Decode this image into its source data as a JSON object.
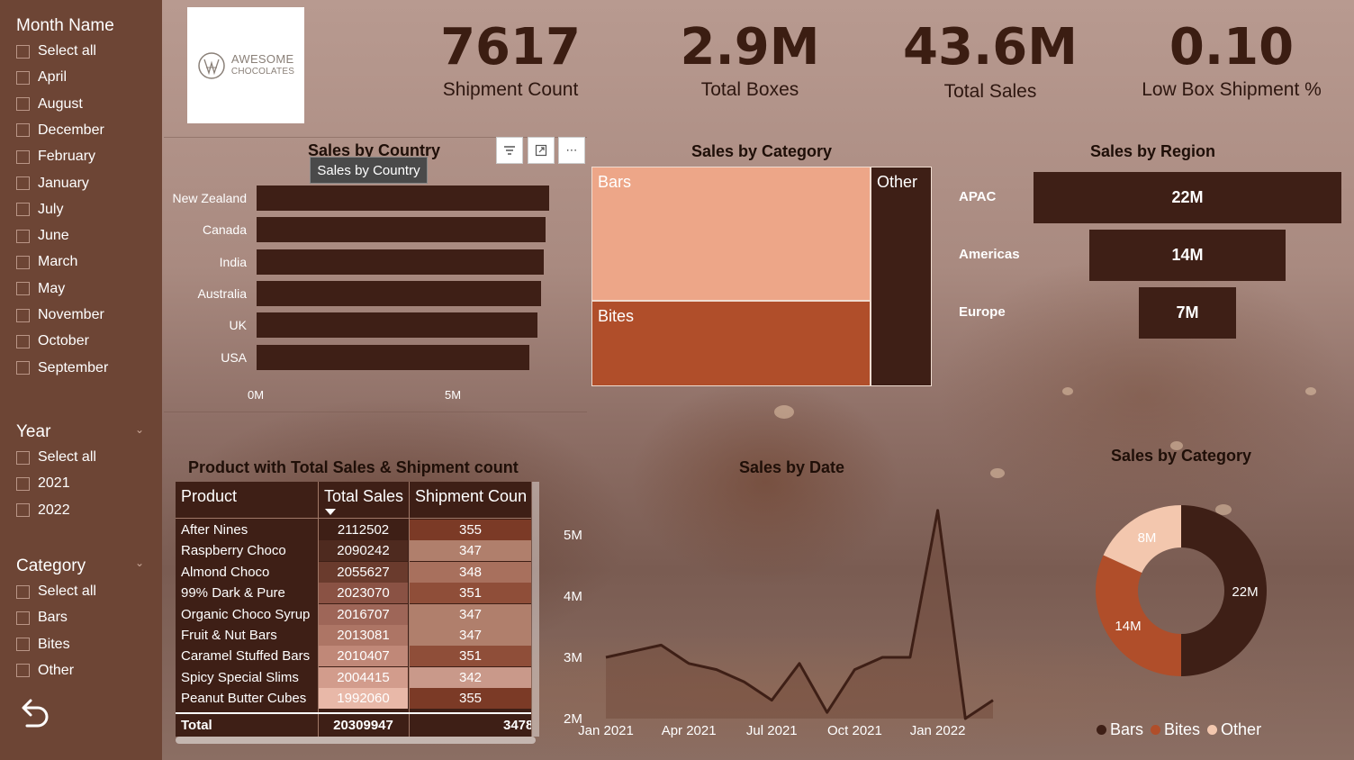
{
  "sidebar": {
    "month": {
      "title": "Month Name",
      "items": [
        "Select all",
        "April",
        "August",
        "December",
        "February",
        "January",
        "July",
        "June",
        "March",
        "May",
        "November",
        "October",
        "September"
      ]
    },
    "year": {
      "title": "Year",
      "items": [
        "Select all",
        "2021",
        "2022"
      ]
    },
    "category": {
      "title": "Category",
      "items": [
        "Select all",
        "Bars",
        "Bites",
        "Other"
      ]
    }
  },
  "logo": {
    "line1": "AWESOME",
    "line2": "CHOCOLATES"
  },
  "kpis": [
    {
      "value": "7617",
      "label": "Shipment Count"
    },
    {
      "value": "2.9M",
      "label": "Total Boxes"
    },
    {
      "value": "43.6M",
      "label": "Total Sales"
    },
    {
      "value": "0.10",
      "label": "Low Box Shipment %"
    }
  ],
  "country": {
    "title": "Sales by Country",
    "tooltip": "Sales by Country",
    "ticks": [
      "0M",
      "5M"
    ]
  },
  "treemap": {
    "title": "Sales by Category"
  },
  "region": {
    "title": "Sales by Region"
  },
  "table": {
    "title": "Product with Total Sales & Shipment count",
    "headers": [
      "Product",
      "Total Sales",
      "Shipment Coun"
    ],
    "rows": [
      {
        "product": "After Nines",
        "sales": "2112502",
        "shipments": "355"
      },
      {
        "product": "Raspberry Choco",
        "sales": "2090242",
        "shipments": "347"
      },
      {
        "product": "Almond Choco",
        "sales": "2055627",
        "shipments": "348"
      },
      {
        "product": "99% Dark & Pure",
        "sales": "2023070",
        "shipments": "351"
      },
      {
        "product": "Organic Choco Syrup",
        "sales": "2016707",
        "shipments": "347"
      },
      {
        "product": "Fruit & Nut Bars",
        "sales": "2013081",
        "shipments": "347"
      },
      {
        "product": "Caramel Stuffed Bars",
        "sales": "2010407",
        "shipments": "351"
      },
      {
        "product": "Spicy Special Slims",
        "sales": "2004415",
        "shipments": "342"
      },
      {
        "product": "Peanut Butter Cubes",
        "sales": "1992060",
        "shipments": "355"
      }
    ],
    "total": {
      "label": "Total",
      "sales": "20309947",
      "shipments": "3478"
    }
  },
  "date_chart": {
    "title": "Sales by Date",
    "y_ticks": [
      "5M",
      "4M",
      "3M",
      "2M"
    ],
    "x_ticks": [
      "Jan 2021",
      "Apr 2021",
      "Jul 2021",
      "Oct 2021",
      "Jan 2022"
    ]
  },
  "donut": {
    "title": "Sales by Category",
    "labels": [
      "22M",
      "14M",
      "8M"
    ],
    "legend": [
      "Bars",
      "Bites",
      "Other"
    ]
  },
  "colors": {
    "dark": "#3e1f16",
    "bites": "#b04e2a",
    "bars": "#eda688",
    "other_light": "#f3c7ae"
  },
  "chart_data": [
    {
      "type": "bar",
      "title": "Sales by Country",
      "categories": [
        "New Zealand",
        "Canada",
        "India",
        "Australia",
        "UK",
        "USA"
      ],
      "values": [
        7.5,
        7.4,
        7.35,
        7.3,
        7.2,
        7.0
      ],
      "xlim": [
        0,
        7.5
      ],
      "x_ticks": [
        "0M",
        "5M"
      ]
    },
    {
      "type": "heatmap",
      "title": "Sales by Category",
      "categories": [
        "Bars",
        "Bites",
        "Other"
      ],
      "values": [
        22,
        14,
        8
      ]
    },
    {
      "type": "bar",
      "title": "Sales by Region",
      "categories": [
        "APAC",
        "Americas",
        "Europe"
      ],
      "values": [
        22,
        14,
        7
      ],
      "labels": [
        "22M",
        "14M",
        "7M"
      ]
    },
    {
      "type": "area",
      "title": "Sales by Date",
      "x": [
        "2021-01",
        "2021-02",
        "2021-03",
        "2021-04",
        "2021-05",
        "2021-06",
        "2021-07",
        "2021-08",
        "2021-09",
        "2021-10",
        "2021-11",
        "2021-12",
        "2022-01",
        "2022-02",
        "2022-03"
      ],
      "values": [
        3.0,
        3.1,
        3.2,
        2.9,
        2.8,
        2.6,
        2.3,
        2.9,
        2.1,
        2.8,
        3.0,
        3.0,
        5.4,
        2.0,
        2.3
      ],
      "ylim": [
        2,
        5.5
      ]
    },
    {
      "type": "pie",
      "title": "Sales by Category",
      "categories": [
        "Bars",
        "Bites",
        "Other"
      ],
      "values": [
        22,
        14,
        8
      ]
    }
  ]
}
